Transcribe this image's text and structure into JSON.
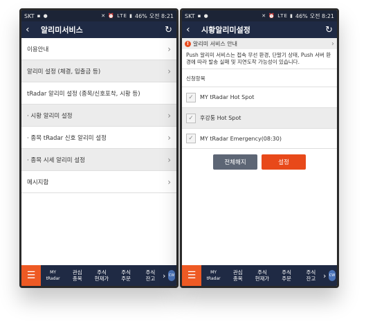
{
  "status": {
    "carrier": "SKT",
    "icons": "▪ ●",
    "signal": "✕ ⏰ LTE ▮",
    "battery": "46%",
    "time": "오전 8:21"
  },
  "left": {
    "title": "알리미서비스",
    "items": [
      {
        "label": "이용안내",
        "chevron": true
      },
      {
        "label": "알리미 설정 (체결, 입출금 등)",
        "chevron": true
      },
      {
        "label": "tRadar 알리미 설정 (종목/신호포착, 시황 등)",
        "chevron": false
      },
      {
        "label": "· 시황 알리미 설정",
        "chevron": true
      },
      {
        "label": "· 종목 tRadar 신호 알리미 설정",
        "chevron": true
      },
      {
        "label": "· 종목 시세 알리미 설정",
        "chevron": true
      },
      {
        "label": "메시지함",
        "chevron": true
      }
    ]
  },
  "right": {
    "title": "시황알리미설정",
    "notice_title": "알리미 서비스 안내",
    "notice_text": "Push 알리미 서비스는 접속 무선 환경, 단말기 상태, Push 서버 환경에 따라 발송 실패 및 지연도착 가능성이 있습니다.",
    "section_label": "신청항목",
    "options": [
      {
        "label": "MY tRadar Hot Spot"
      },
      {
        "label": "후강퉁 Hot Spot"
      },
      {
        "label": "MY tRadar Emergency(08:30)"
      }
    ],
    "cancel_all": "전체해지",
    "set": "설정"
  },
  "bottom": {
    "tabs": [
      "MY\ntRadar",
      "관심\n종목",
      "주식\n현재가",
      "주식\n주문",
      "주식\n잔고"
    ],
    "cw": "CW"
  },
  "colors": {
    "header": "#1f2a44",
    "accent": "#ee5a24",
    "button_gray": "#5d6675",
    "button_orange": "#e8491a"
  }
}
